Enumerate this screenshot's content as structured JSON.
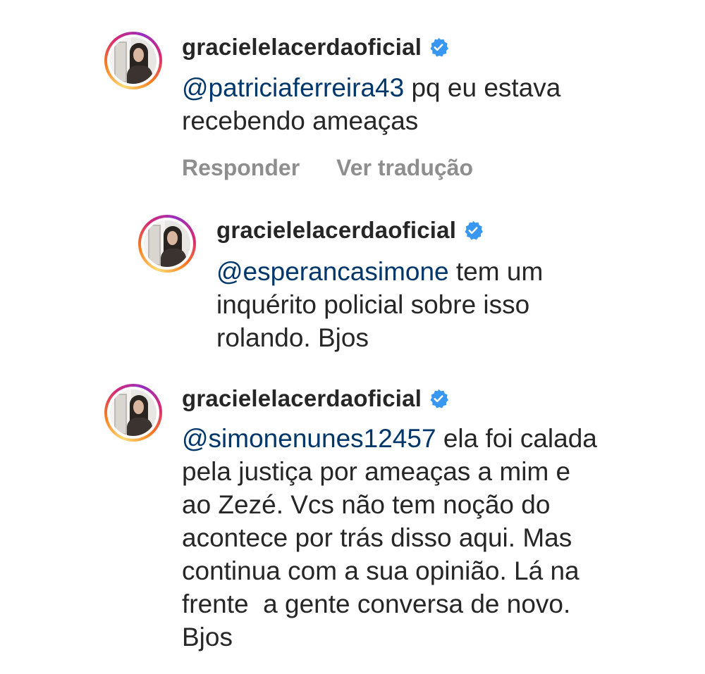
{
  "comments": [
    {
      "username": "gracielelacerdaoficial",
      "mention": "@patriciaferreira43",
      "lines": [
        " pq eu estava",
        "recebendo ameaças"
      ],
      "actions": {
        "reply": "Responder",
        "translate": "Ver tradução"
      }
    },
    {
      "username": "gracielelacerdaoficial",
      "mention": "@esperancasimone",
      "lines": [
        " tem um",
        "inquérito policial sobre isso",
        "rolando. Bjos"
      ]
    },
    {
      "username": "gracielelacerdaoficial",
      "mention": "@simonenunes12457",
      "lines": [
        " ela foi calada",
        "pela justiça por ameaças a mim e",
        "ao Zezé. Vcs não tem noção do",
        "acontece por trás disso aqui. Mas",
        "continua com a sua opinião. Lá na",
        "frente  a gente conversa de novo.",
        "Bjos"
      ]
    }
  ],
  "colors": {
    "mention": "#00376b",
    "verified": "#3897f0",
    "text": "#262626",
    "muted": "#8e8e8e"
  },
  "icons": {
    "verified": "verified-badge-icon"
  }
}
